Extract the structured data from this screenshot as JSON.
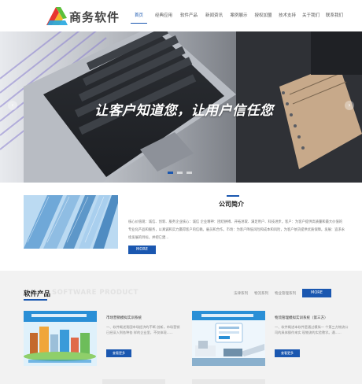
{
  "header": {
    "logo_text": "商务软件",
    "nav": [
      {
        "label": "首页",
        "active": true
      },
      {
        "label": "经典应用",
        "active": false
      },
      {
        "label": "软件产品",
        "active": false
      },
      {
        "label": "新闻资讯",
        "active": false
      },
      {
        "label": "案例展示",
        "active": false
      },
      {
        "label": "授权加盟",
        "active": false
      },
      {
        "label": "技术支持",
        "active": false
      },
      {
        "label": "关于我们",
        "active": false
      },
      {
        "label": "联系我们",
        "active": false
      }
    ]
  },
  "banner": {
    "slogan": "让客户知道您，让用户信任您",
    "prev_icon": "chevron-left-icon",
    "next_icon": "chevron-right-icon",
    "slide_count": 3,
    "active_slide": 0
  },
  "about": {
    "title": "公司简介",
    "text": "核心价值观：诚信、创新、服务企业核心：诚信 企业精神：团结拼搏、开拓进取、满足用户、科技进步。客户：为客户提供高质量和最大价值的专业化产品和服务，以真诚和实力赢得客户的信赖。雇员和合作。市场：为客户降低风险和成本和风险，为客户依货提供优质保障。发展：追求永续发展的目标，并把它建...",
    "more_label": "MORE"
  },
  "products": {
    "title": "软件产品",
    "title_en": "SOFTWARE PRODUCT",
    "tabs": [
      "法律系列",
      "物流系列",
      "物业管理系列"
    ],
    "more_label": "MORE",
    "items": [
      {
        "title": "市场营销模拟实训系统",
        "desc": "一、软件概述我国市场经济的不断 创新，市场营销已经深入到各种各 样的企业里，不仅体现......",
        "button": "查看更多"
      },
      {
        "title": "物流管理模拟实训系统（第三方）",
        "desc": "一、软件概述本软件是通过模拟一 个第三方物流公司的具体操作来实 现物流的实验教学。通......",
        "button": "查看更多"
      }
    ]
  },
  "colors": {
    "accent": "#1a57b0",
    "products_bg": "#f2f2f2"
  }
}
